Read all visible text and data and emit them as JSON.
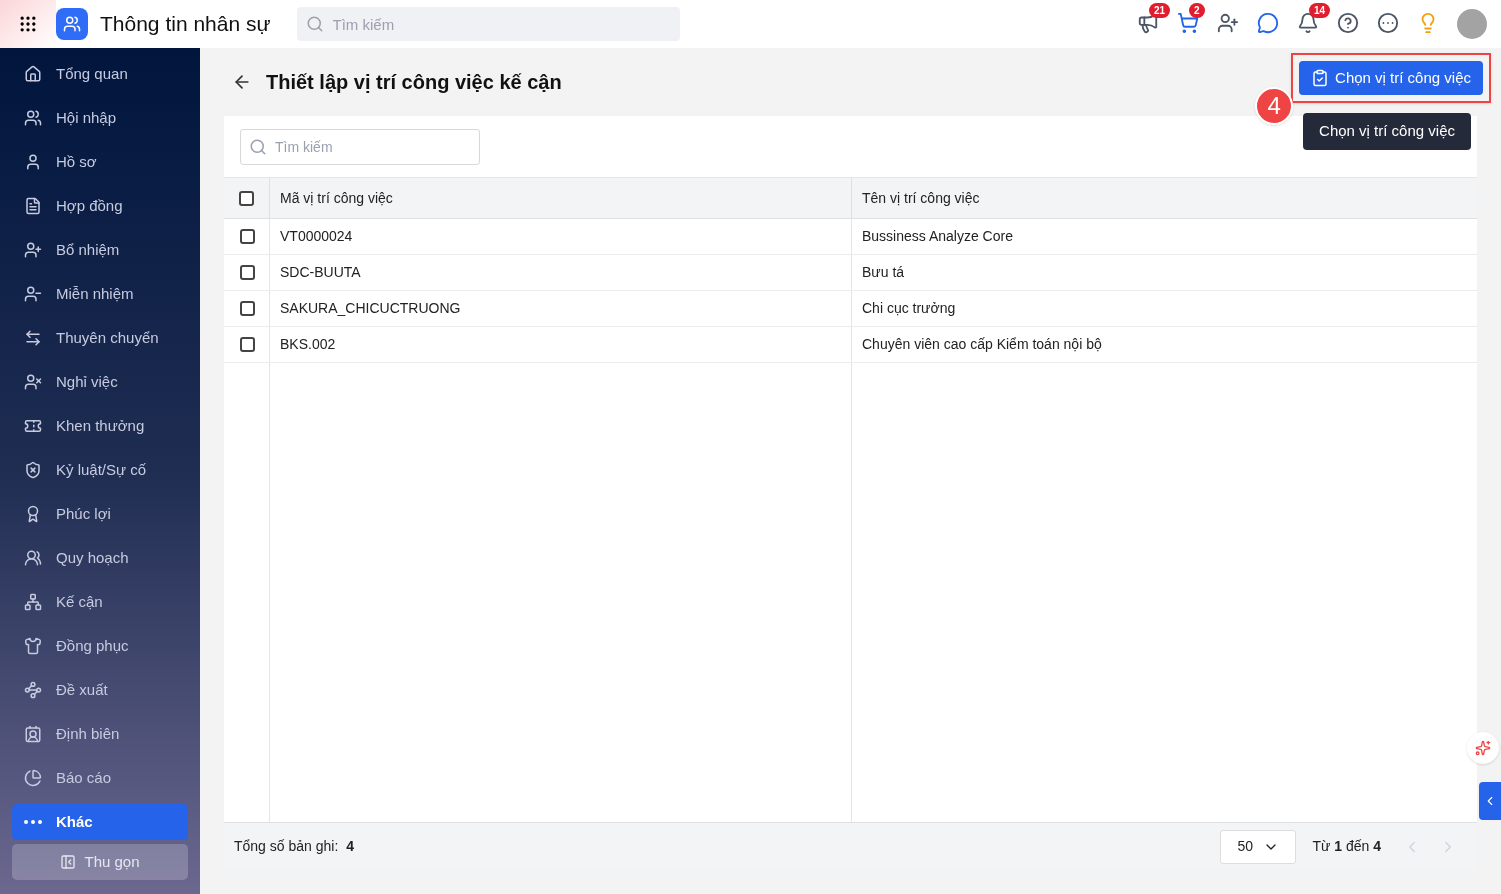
{
  "app": {
    "title": "Thông tin nhân sự",
    "search_placeholder": "Tìm kiếm"
  },
  "top_badges": [
    {
      "kind": "megaphone",
      "badge": "21"
    },
    {
      "kind": "cart",
      "badge": "2"
    },
    {
      "kind": "user-add"
    },
    {
      "kind": "chat"
    },
    {
      "kind": "bell",
      "badge": "14"
    },
    {
      "kind": "help"
    },
    {
      "kind": "more"
    },
    {
      "kind": "idea"
    }
  ],
  "sidebar": {
    "items": [
      {
        "label": "Tổng quan",
        "selected": false
      },
      {
        "label": "Hội nhập",
        "selected": false
      },
      {
        "label": "Hồ sơ",
        "selected": false
      },
      {
        "label": "Hợp đồng",
        "selected": false
      },
      {
        "label": "Bổ nhiệm",
        "selected": false
      },
      {
        "label": "Miễn nhiệm",
        "selected": false
      },
      {
        "label": "Thuyên chuyển",
        "selected": false
      },
      {
        "label": "Nghỉ việc",
        "selected": false
      },
      {
        "label": "Khen thưởng",
        "selected": false
      },
      {
        "label": "Kỷ luật/Sự cố",
        "selected": false
      },
      {
        "label": "Phúc lợi",
        "selected": false
      },
      {
        "label": "Quy hoạch",
        "selected": false
      },
      {
        "label": "Kế cận",
        "selected": false
      },
      {
        "label": "Đồng phục",
        "selected": false
      },
      {
        "label": "Đề xuất",
        "selected": false
      },
      {
        "label": "Định biên",
        "selected": false
      },
      {
        "label": "Báo cáo",
        "selected": false
      },
      {
        "label": "Khác",
        "selected": true
      }
    ],
    "collapse": "Thu gọn"
  },
  "page": {
    "title": "Thiết lập vị trí công việc kế cận",
    "action_button": "Chọn vị trí công việc",
    "tooltip": "Chọn vị trí công việc",
    "step_marker": "4"
  },
  "table": {
    "search_placeholder": "Tìm kiếm",
    "columns": [
      "Mã vị trí công việc",
      "Tên vị trí công việc"
    ],
    "all_checked": false,
    "rows": [
      {
        "code": "VT0000024",
        "name": "Bussiness Analyze Core",
        "checked": false
      },
      {
        "code": "SDC-BUUTA",
        "name": "Bưu tá",
        "checked": false
      },
      {
        "code": "SAKURA_CHICUCTRUONG",
        "name": "Chi cục trưởng",
        "checked": false
      },
      {
        "code": "BKS.002",
        "name": "Chuyên viên cao cấp Kiểm toán nội bộ",
        "checked": false
      }
    ]
  },
  "footer": {
    "total_label": "Tổng số bản ghi:",
    "total": "4",
    "page_size": "50",
    "range": "Từ **1** đến **4**"
  }
}
